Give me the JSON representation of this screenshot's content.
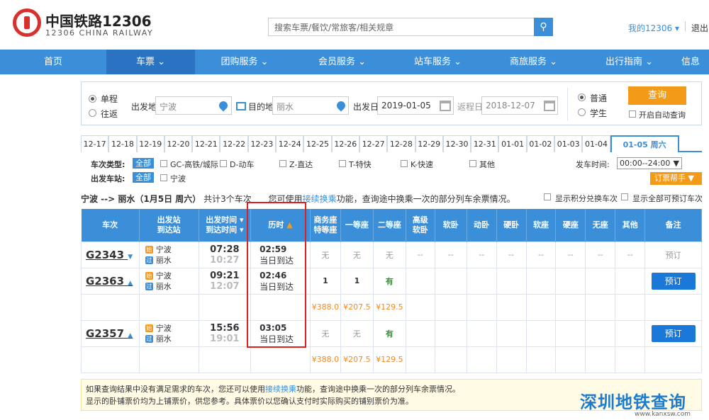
{
  "header": {
    "logo_cn": "中国铁路12306",
    "logo_en": "12306 CHINA RAILWAY",
    "search_placeholder": "搜索车票/餐饮/常旅客/相关规章",
    "my12306": "我的12306",
    "logout": "退出"
  },
  "nav": [
    {
      "label": "首页"
    },
    {
      "label": "车票"
    },
    {
      "label": "团购服务"
    },
    {
      "label": "会员服务"
    },
    {
      "label": "站车服务"
    },
    {
      "label": "商旅服务"
    },
    {
      "label": "出行指南"
    },
    {
      "label": "信息"
    }
  ],
  "form": {
    "single": "单程",
    "round": "往返",
    "from_label": "出发地",
    "from_value": "宁波",
    "to_label": "目的地",
    "to_value": "丽水",
    "date_label": "出发日",
    "date_value": "2019-01-05",
    "return_label": "返程日",
    "return_value": "2018-12-07",
    "normal": "普通",
    "student": "学生",
    "query": "查询",
    "auto_query": "开启自动查询"
  },
  "dates": [
    "12-17",
    "12-18",
    "12-19",
    "12-20",
    "12-21",
    "12-22",
    "12-23",
    "12-24",
    "12-25",
    "12-26",
    "12-27",
    "12-28",
    "12-29",
    "12-30",
    "12-31",
    "01-01",
    "01-02",
    "01-03",
    "01-04"
  ],
  "selected_date": "01-05 周六",
  "filters": {
    "type_label": "车次类型:",
    "all": "全部",
    "types": [
      "GC-高铁/城际",
      "D-动车",
      "Z-直达",
      "T-特快",
      "K-快速",
      "其他"
    ],
    "station_label": "出发车站:",
    "station_all": "全部",
    "station": "宁波",
    "depart_time_label": "发车时间:",
    "depart_time_value": "00:00--24:00",
    "help": "订票帮手"
  },
  "summary": {
    "route": "宁波 --> 丽水（1月5日 周六）",
    "count": "共计3个车次",
    "tip_pre": "您可使用",
    "tip_link": "接续换乘",
    "tip_post": "功能，查询途中换乘一次的部分列车余票情况。",
    "show_points": "显示积分兑换车次",
    "show_bookable": "显示全部可预订车次"
  },
  "table": {
    "headers": {
      "train": "车次",
      "station": [
        "出发站",
        "到达站"
      ],
      "time": [
        "出发时间",
        "到达时间"
      ],
      "duration": "历时",
      "business": [
        "商务座",
        "特等座"
      ],
      "first": "一等座",
      "second": "二等座",
      "premium": [
        "高级",
        "软卧"
      ],
      "soft_sleeper": "软卧",
      "emu_sleeper": "动卧",
      "hard_sleeper": "硬卧",
      "soft_seat": "软座",
      "hard_seat": "硬座",
      "no_seat": "无座",
      "other": "其他",
      "note": "备注"
    },
    "rows": [
      {
        "no": "G2343",
        "from": "宁波",
        "to": "丽水",
        "dep": "07:28",
        "arr": "10:27",
        "dur": "02:59",
        "day": "当日到达",
        "biz": "无",
        "first": "无",
        "second": "无",
        "rest": "--",
        "book": "预订",
        "bookable": false,
        "prices": null
      },
      {
        "no": "G2363",
        "from": "宁波",
        "to": "丽水",
        "dep": "09:21",
        "arr": "12:07",
        "dur": "02:46",
        "day": "当日到达",
        "biz": "1",
        "first": "1",
        "second": "有",
        "rest": "",
        "book": "预订",
        "bookable": true,
        "prices": [
          "¥388.0",
          "¥207.5",
          "¥129.5"
        ]
      },
      {
        "no": "G2357",
        "from": "宁波",
        "to": "丽水",
        "dep": "15:56",
        "arr": "19:01",
        "dur": "03:05",
        "day": "当日到达",
        "biz": "无",
        "first": "无",
        "second": "有",
        "rest": "",
        "book": "预订",
        "bookable": true,
        "prices": [
          "¥388.0",
          "¥207.5",
          "¥129.5"
        ]
      }
    ]
  },
  "notice": [
    "如果查询结果中没有满足需求的车次，您还可以使用",
    "接续换乘",
    "功能，查询途中换乘一次的部分列车余票情况。",
    "显示的卧铺票价均为上铺票价，供您参考。具体票价以您确认支付时实际购买的铺别票价为准。"
  ],
  "watermark": {
    "text": "深圳地铁查询",
    "sub": "www.kanxsw.com"
  },
  "colors": {
    "primary": "#3b8fd8",
    "orange": "#f39a19",
    "highlight": "#e02020"
  }
}
